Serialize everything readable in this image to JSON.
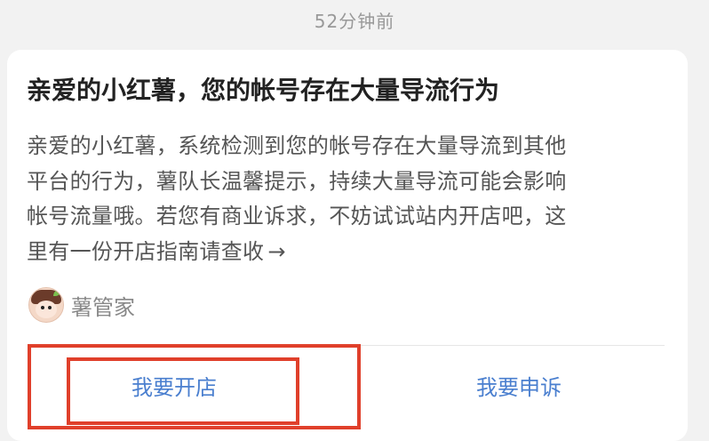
{
  "timestamp": "52分钟前",
  "notice": {
    "title": "亲爱的小红薯，您的帐号存在大量导流行为",
    "body_lines": [
      "亲爱的小红薯，系统检测到您的帐号存在大量导流到其他",
      "平台的行为，薯队长温馨提示，持续大量导流可能会影响",
      "帐号流量哦。若您有商业诉求，不妨试试站内开店吧，这",
      "里有一份开店指南请查收"
    ],
    "link_arrow": "→",
    "sender": {
      "name": "薯管家",
      "avatar_icon": "cartoon-avatar-icon"
    },
    "actions": {
      "open_store_label": "我要开店",
      "appeal_label": "我要申诉"
    }
  },
  "colors": {
    "background": "#f2f2f2",
    "card": "#ffffff",
    "action_text": "#4a7fcf",
    "annotation_highlight": "#e0402b"
  }
}
